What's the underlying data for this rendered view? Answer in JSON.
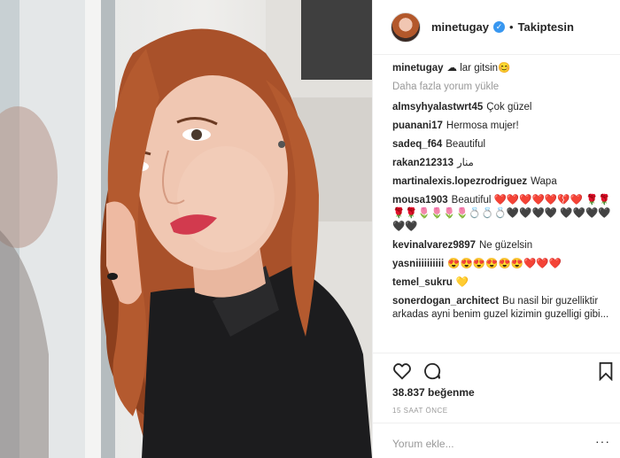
{
  "post": {
    "username": "minetugay",
    "verified_icon": "verified-badge-icon",
    "follow_separator": "•",
    "follow_state": "Takiptesin"
  },
  "caption": {
    "username": "minetugay",
    "text": "lar gitsin",
    "icons": [
      "cloud-icon",
      "smile-emoji"
    ]
  },
  "load_more": "Daha fazla yorum yükle",
  "comments": [
    {
      "user": "almsyhyalastwrt45",
      "text": "Çok güzel"
    },
    {
      "user": "puanani17",
      "text": "Hermosa mujer!"
    },
    {
      "user": "sadeq_f64",
      "text": "Beautiful"
    },
    {
      "user": "rakan212313",
      "text": "منار"
    },
    {
      "user": "martinalexis.lopezrodriguez",
      "text": "Wapa"
    },
    {
      "user": "mousa1903",
      "text": "Beautiful ❤️❤️❤️❤️❤️💔❤️ 🌹🌹🌹🌹🌷🌷🌷🌷💍💍💍🖤🖤🖤🖤 🖤🖤🖤🖤🖤🖤"
    },
    {
      "user": "kevinalvarez9897",
      "text": "Ne güzelsin"
    },
    {
      "user": "yasniiiiiiiiii",
      "text": "😍😍😍😍😍😍❤️❤️❤️"
    },
    {
      "user": "temel_sukru",
      "text": "💛"
    },
    {
      "user": "sonerdogan_architect",
      "text": "Bu nasil bir guzelliktir arkadas ayni benim guzel kizimin guzelligi gibi..."
    }
  ],
  "actions": {
    "like_icon": "heart-icon",
    "comment_icon": "comment-icon",
    "save_icon": "bookmark-icon"
  },
  "likes": "38.837 beğenme",
  "timestamp": "15 SAAT ÖNCE",
  "add_comment": {
    "placeholder": "Yorum ekle...",
    "more": "···"
  },
  "colors": {
    "link": "#262626",
    "muted": "#999999",
    "verified": "#3897f0",
    "border": "#efefef"
  }
}
